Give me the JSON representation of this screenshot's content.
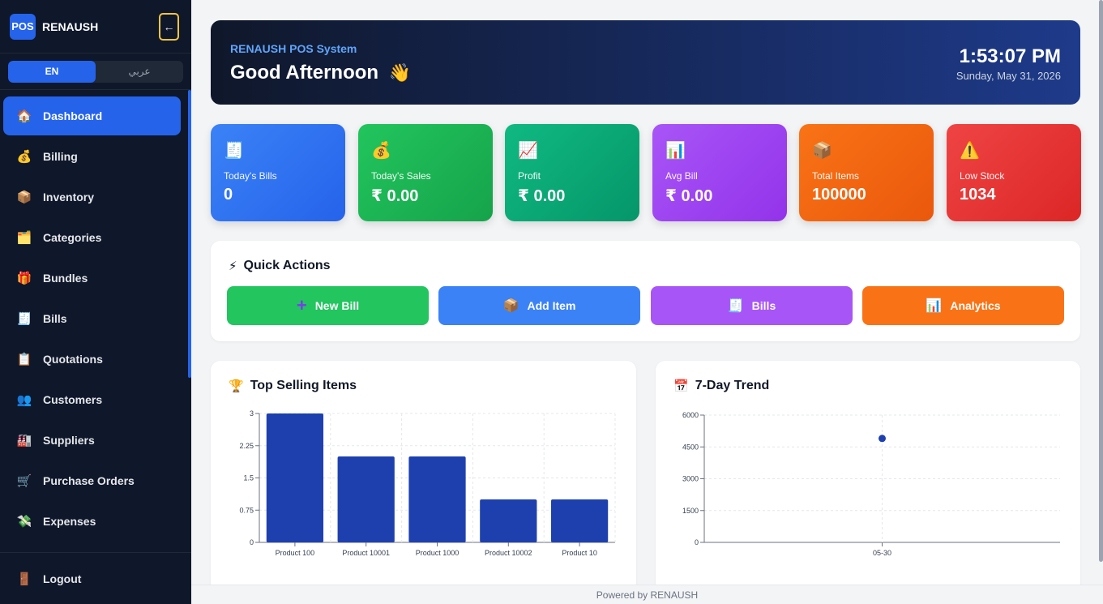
{
  "brand": {
    "logo": "POS",
    "name": "RENAUSH",
    "collapse_icon": "←"
  },
  "language": {
    "options": [
      "EN",
      "عربي"
    ],
    "selected": "EN"
  },
  "sidebar": {
    "items": [
      {
        "label": "Dashboard",
        "icon": "🏠",
        "active": true
      },
      {
        "label": "Billing",
        "icon": "💰"
      },
      {
        "label": "Inventory",
        "icon": "📦"
      },
      {
        "label": "Categories",
        "icon": "🗂️"
      },
      {
        "label": "Bundles",
        "icon": "🎁"
      },
      {
        "label": "Bills",
        "icon": "🧾"
      },
      {
        "label": "Quotations",
        "icon": "📋"
      },
      {
        "label": "Customers",
        "icon": "👥"
      },
      {
        "label": "Suppliers",
        "icon": "🏭"
      },
      {
        "label": "Purchase Orders",
        "icon": "🛒"
      },
      {
        "label": "Expenses",
        "icon": "💸"
      }
    ],
    "logout": {
      "label": "Logout",
      "icon": "🚪"
    }
  },
  "hero": {
    "system": "RENAUSH POS System",
    "greeting": "Good Afternoon",
    "wave": "👋",
    "time": "1:53:07 PM",
    "date": "Sunday, May 31, 2026"
  },
  "stats": [
    {
      "label": "Today's Bills",
      "value": "0",
      "icon": "🧾",
      "color": "#3b82f6"
    },
    {
      "label": "Today's Sales",
      "value": "₹ 0.00",
      "icon": "💰",
      "color": "#22c55e"
    },
    {
      "label": "Profit",
      "value": "₹ 0.00",
      "icon": "📈",
      "color": "#10b981"
    },
    {
      "label": "Avg Bill",
      "value": "₹ 0.00",
      "icon": "📊",
      "color": "#a855f7"
    },
    {
      "label": "Total Items",
      "value": "100000",
      "icon": "📦",
      "color": "#f97316"
    },
    {
      "label": "Low Stock",
      "value": "1034",
      "icon": "⚠️",
      "color": "#ef4444"
    }
  ],
  "quick_actions": {
    "title": "Quick Actions",
    "icon": "⚡",
    "buttons": [
      {
        "label": "New Bill",
        "icon": "+",
        "color": "#22c55e"
      },
      {
        "label": "Add Item",
        "icon": "📦",
        "color": "#3b82f6"
      },
      {
        "label": "Bills",
        "icon": "🧾",
        "color": "#a855f7"
      },
      {
        "label": "Analytics",
        "icon": "📊",
        "color": "#f97316"
      }
    ]
  },
  "top_selling": {
    "title": "Top Selling Items",
    "icon": "🏆"
  },
  "trend": {
    "title": "7-Day Trend",
    "icon": "📅"
  },
  "chart_data": [
    {
      "type": "bar",
      "title": "Top Selling Items",
      "categories": [
        "Product 100",
        "Product 10001",
        "Product 1000",
        "Product 10002",
        "Product 10"
      ],
      "values": [
        3,
        2,
        2,
        1,
        1
      ],
      "ylim": [
        0,
        3
      ],
      "yticks": [
        "0",
        "0.75",
        "1.5",
        "2.25",
        "3"
      ],
      "color": "#1e40af",
      "grid": true
    },
    {
      "type": "scatter",
      "title": "7-Day Trend",
      "x": [
        "05-30"
      ],
      "values": [
        4900
      ],
      "ylim": [
        0,
        6000
      ],
      "yticks": [
        "0",
        "1500",
        "3000",
        "4500",
        "6000"
      ],
      "color": "#1e40af",
      "grid": true
    }
  ],
  "footer": "Powered by RENAUSH"
}
